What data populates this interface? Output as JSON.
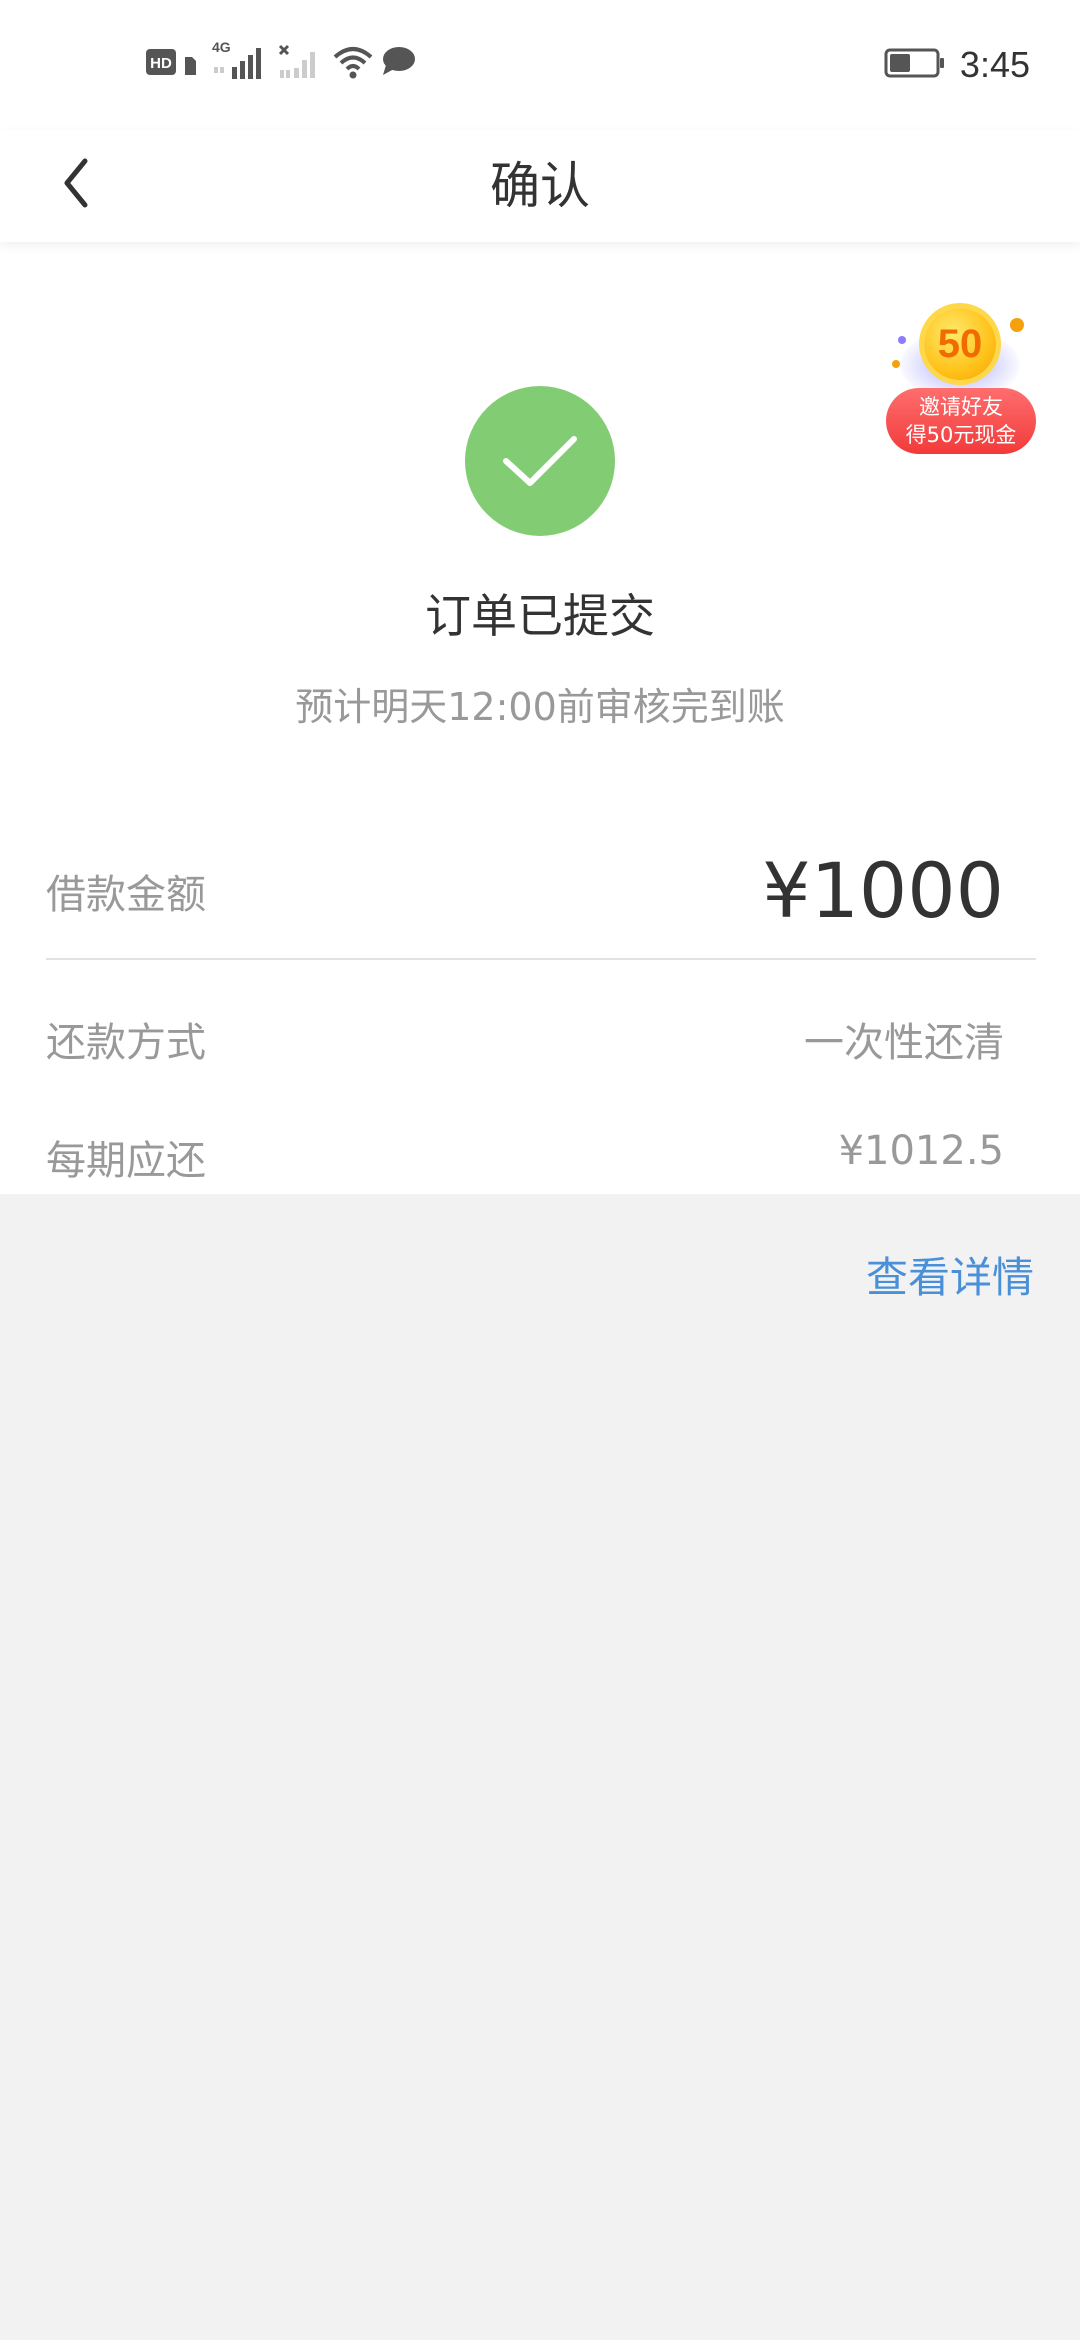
{
  "status_bar": {
    "network_label": "4G",
    "time": "3:45",
    "icons": [
      "hd-icon",
      "sim-icon",
      "signal-4g-icon",
      "signal-no-sim-icon",
      "wifi-icon",
      "chat-bubble-icon",
      "battery-icon"
    ]
  },
  "nav": {
    "title": "确认"
  },
  "promo": {
    "coin_value": "50",
    "line1": "邀请好友",
    "line2": "得50元现金"
  },
  "result": {
    "title": "订单已提交",
    "subtitle": "预计明天12:00前审核完到账"
  },
  "loan": {
    "amount_label": "借款金额",
    "amount_value": "¥1000",
    "repay_method_label": "还款方式",
    "repay_method_value": "一次性还清",
    "per_period_label": "每期应还",
    "per_period_value": "¥1012.5"
  },
  "actions": {
    "view_details": "查看详情"
  },
  "colors": {
    "success_green": "#82cd73",
    "link_blue": "#4a90d9",
    "promo_red": "#f23a3a",
    "background": "#f2f2f2"
  }
}
